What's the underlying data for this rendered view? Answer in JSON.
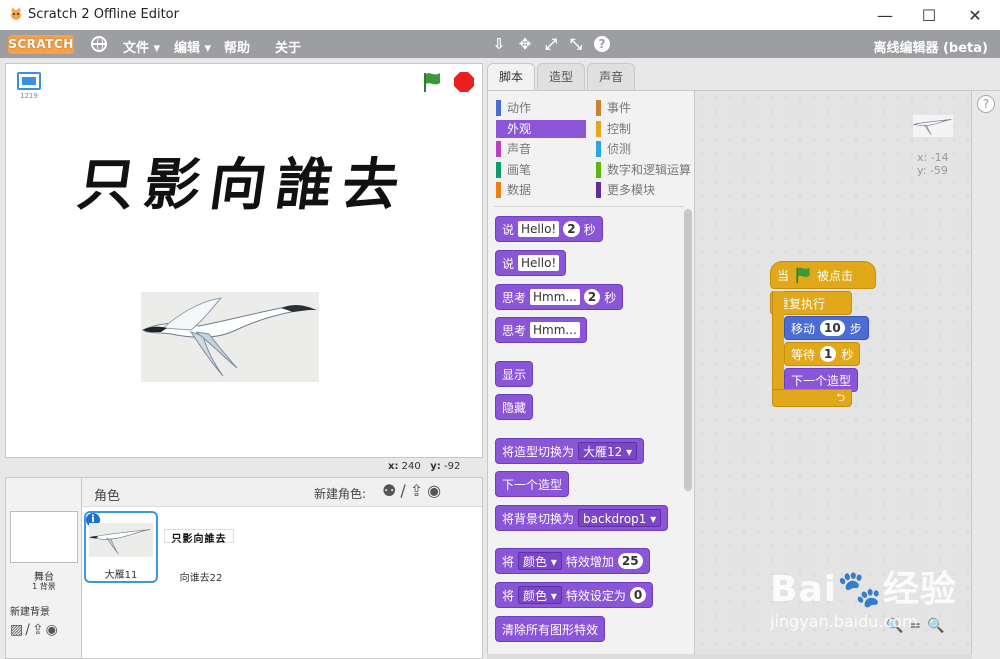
{
  "window": {
    "title": "Scratch 2 Offline Editor",
    "minimize": "—",
    "maximize": "☐",
    "close": "✕"
  },
  "menubar": {
    "logo": "SCRATCH",
    "file": "文件 ▾",
    "edit": "编辑 ▾",
    "tips": "帮助",
    "about": "关于",
    "tools": [
      "⇩",
      "✥",
      "⤢",
      "⤡"
    ],
    "help": "?",
    "offline": "离线编辑器 (beta)"
  },
  "stage": {
    "version": "1219",
    "title_text": "只影向誰去",
    "coord_x_label": "x:",
    "coord_x": "240",
    "coord_y_label": "y:",
    "coord_y": "-92"
  },
  "sprites": {
    "stage_label": "舞台",
    "stage_sub": "1 背景",
    "new_backdrop": "新建背景",
    "header": "角色",
    "new_sprite": "新建角色:",
    "new_sprite_icons": "⚉/⇪◉",
    "new_backdrop_icons": "▨/⇪◉",
    "items": [
      {
        "name": "大雁11",
        "info": "i"
      },
      {
        "name": "向谁去22",
        "mini_text": "只影向誰去"
      }
    ]
  },
  "tabs": [
    "脚本",
    "造型",
    "声音"
  ],
  "categories": [
    {
      "label": "动作",
      "color": "#4a6cd4"
    },
    {
      "label": "事件",
      "color": "#c88330"
    },
    {
      "label": "外观",
      "color": "#8a55d7"
    },
    {
      "label": "控制",
      "color": "#e1a91a"
    },
    {
      "label": "声音",
      "color": "#bb42c3"
    },
    {
      "label": "侦测",
      "color": "#2ca5e2"
    },
    {
      "label": "画笔",
      "color": "#0e9a6c"
    },
    {
      "label": "数字和逻辑运算",
      "color": "#5cb712"
    },
    {
      "label": "数据",
      "color": "#ee7d16"
    },
    {
      "label": "更多模块",
      "color": "#632d99"
    }
  ],
  "blocks": {
    "say_secs": {
      "t1": "说",
      "f1": "Hello!",
      "n1": "2",
      "t2": "秒"
    },
    "say": {
      "t1": "说",
      "f1": "Hello!"
    },
    "think_secs": {
      "t1": "思考",
      "f1": "Hmm...",
      "n1": "2",
      "t2": "秒"
    },
    "think": {
      "t1": "思考",
      "f1": "Hmm..."
    },
    "show": "显示",
    "hide": "隐藏",
    "switch_costume": {
      "t1": "将造型切换为",
      "dd": "大雁12 ▾"
    },
    "next_costume": "下一个造型",
    "switch_backdrop": {
      "t1": "将背景切换为",
      "dd": "backdrop1 ▾"
    },
    "change_effect": {
      "t1": "将",
      "dd": "颜色 ▾",
      "t2": "特效增加",
      "n1": "25"
    },
    "set_effect": {
      "t1": "将",
      "dd": "颜色 ▾",
      "t2": "特效设定为",
      "n1": "0"
    },
    "clear_effects": "清除所有图形特效"
  },
  "script": {
    "hat": {
      "t1": "当",
      "t2": "被点击"
    },
    "forever": "重复执行",
    "move": {
      "t1": "移动",
      "n1": "10",
      "t2": "步"
    },
    "wait": {
      "t1": "等待",
      "n1": "1",
      "t2": "秒"
    },
    "next_costume": "下一个造型",
    "loop_arrow": "⮌",
    "sprite_x": "x: -14",
    "sprite_y": "y: -59"
  },
  "right": {
    "help": "?"
  },
  "zoom": "🔍=🔍",
  "watermark": {
    "big": "Bai🐾经验",
    "small": "jingyan.baidu.com"
  }
}
